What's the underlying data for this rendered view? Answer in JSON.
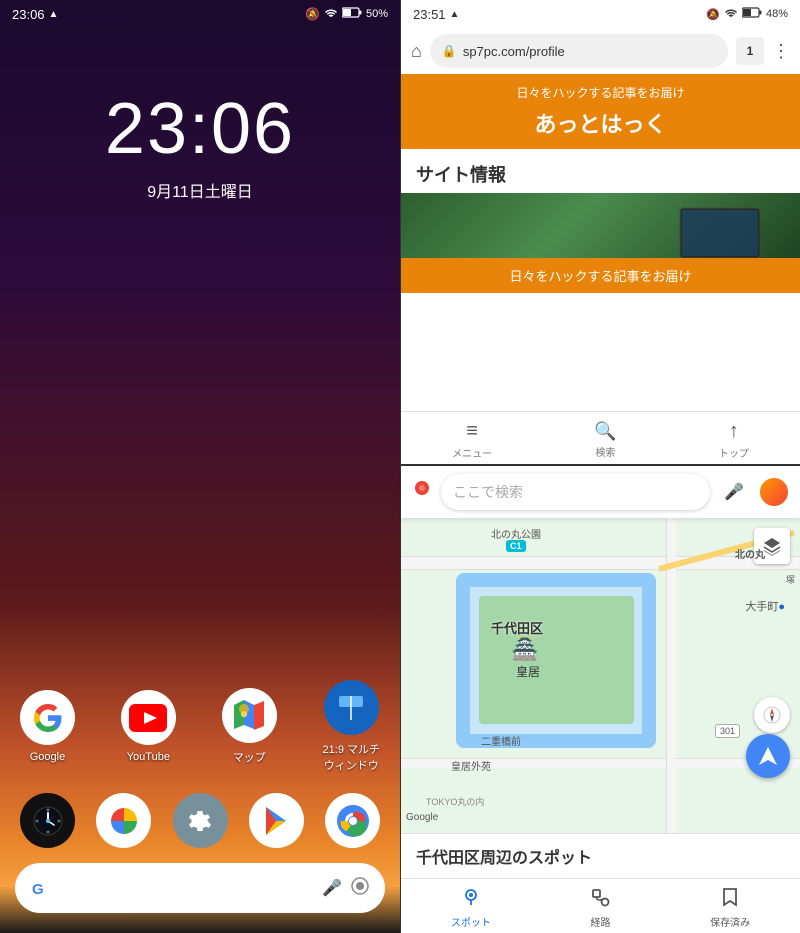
{
  "left": {
    "status_bar": {
      "time": "23:06",
      "alert_icon": "▲",
      "mute_icon": "🔕",
      "wifi_icon": "wifi",
      "battery": "50%"
    },
    "lock_time": "23:06",
    "lock_date": "9月11日土曜日",
    "apps_row1": [
      {
        "name": "Google",
        "label": "Google"
      },
      {
        "name": "YouTube",
        "label": "YouTube"
      },
      {
        "name": "Maps",
        "label": "マップ"
      },
      {
        "name": "MultiWindow",
        "label": "21:9 マルチウィンドウ"
      }
    ],
    "apps_row2": [
      {
        "name": "Clock",
        "label": ""
      },
      {
        "name": "Photos",
        "label": ""
      },
      {
        "name": "Settings",
        "label": ""
      },
      {
        "name": "PlayStore",
        "label": ""
      },
      {
        "name": "Chrome",
        "label": ""
      }
    ]
  },
  "right": {
    "browser": {
      "status_time": "23:51",
      "alert_icon": "▲",
      "battery": "48%",
      "url": "sp7pc.com/profile",
      "tab_count": "1",
      "banner_subtitle": "日々をハックする記事をお届け",
      "banner_title": "あっとはっく",
      "site_info_label": "サイト情報",
      "preview_subtitle": "日々をハックする記事をお届け",
      "nav": {
        "menu_icon": "≡",
        "menu_label": "メニュー",
        "search_icon": "🔍",
        "search_label": "検索",
        "top_icon": "↑",
        "top_label": "トップ"
      }
    },
    "maps": {
      "search_placeholder": "ここで検索",
      "nearby_title": "千代田区周辺のスポット",
      "map_labels": {
        "chiyoda": "千代田区",
        "kokyo": "皇居",
        "otemachi": "大手町●",
        "nijubashi": "二重橋前",
        "gaien": "皇居外苑",
        "kitanomaru": "北の丸公園",
        "c1": "C1",
        "badge_301": "301",
        "tokyo_label": "TOKYO丸の内"
      },
      "nav": {
        "spots_label": "スポット",
        "route_label": "経路",
        "saved_label": "保存済み"
      }
    }
  }
}
